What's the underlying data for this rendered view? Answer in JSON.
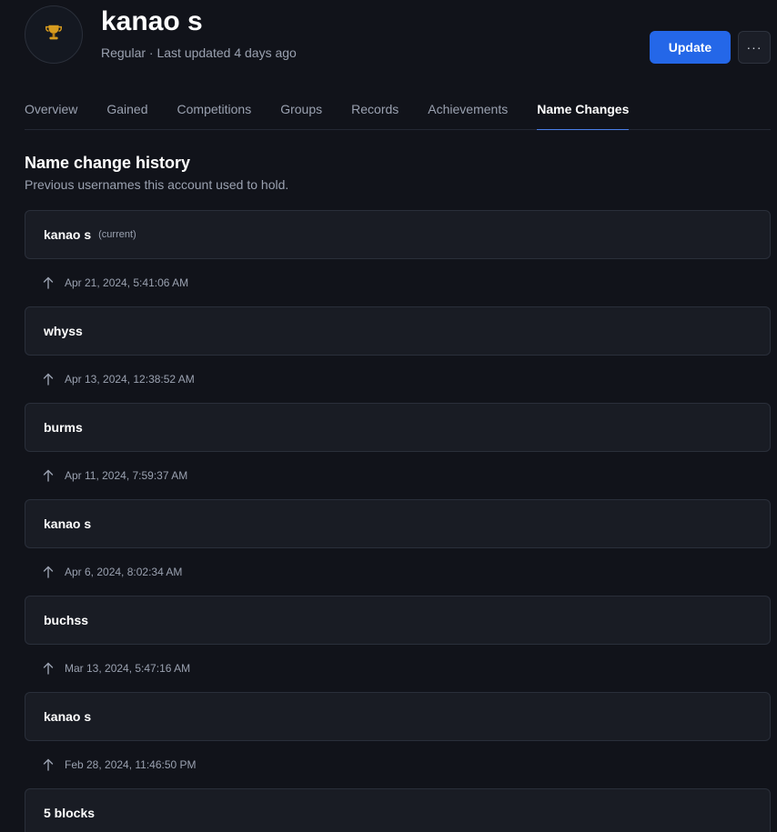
{
  "profile": {
    "avatar_icon": "trophy-icon",
    "username": "kanao s",
    "subline": "Regular · Last updated 4 days ago"
  },
  "actions": {
    "update_label": "Update",
    "more_label": "···"
  },
  "tabs": [
    {
      "label": "Overview",
      "active": false
    },
    {
      "label": "Gained",
      "active": false
    },
    {
      "label": "Competitions",
      "active": false
    },
    {
      "label": "Groups",
      "active": false
    },
    {
      "label": "Records",
      "active": false
    },
    {
      "label": "Achievements",
      "active": false
    },
    {
      "label": "Name Changes",
      "active": true
    }
  ],
  "section": {
    "title": "Name change history",
    "description": "Previous usernames this account used to hold."
  },
  "history": [
    {
      "name": "kanao s",
      "tag": "(current)",
      "changed_at": "Apr 21, 2024, 5:41:06 AM"
    },
    {
      "name": "whyss",
      "tag": "",
      "changed_at": "Apr 13, 2024, 12:38:52 AM"
    },
    {
      "name": "burms",
      "tag": "",
      "changed_at": "Apr 11, 2024, 7:59:37 AM"
    },
    {
      "name": "kanao s",
      "tag": "",
      "changed_at": "Apr 6, 2024, 8:02:34 AM"
    },
    {
      "name": "buchss",
      "tag": "",
      "changed_at": "Mar 13, 2024, 5:47:16 AM"
    },
    {
      "name": "kanao s",
      "tag": "",
      "changed_at": "Feb 28, 2024, 11:46:50 PM"
    },
    {
      "name": "5 blocks",
      "tag": "",
      "changed_at": ""
    }
  ],
  "colors": {
    "background": "#11131a",
    "card": "#191c24",
    "accent": "#2467e8",
    "muted_text": "#9aa1b0"
  }
}
